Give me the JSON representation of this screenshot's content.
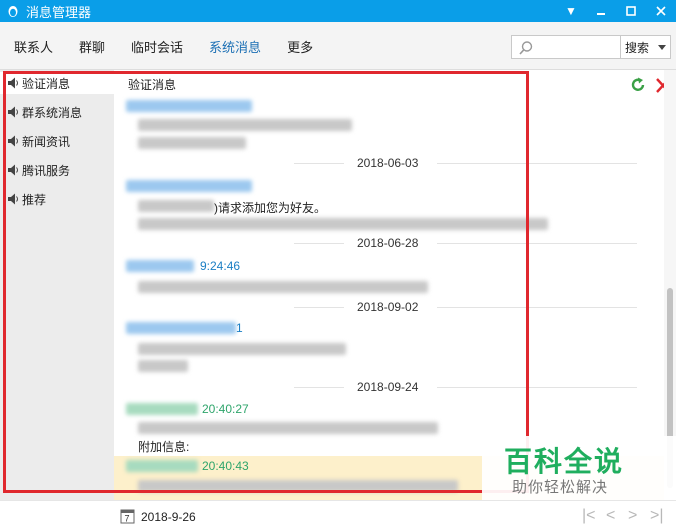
{
  "window": {
    "title": "消息管理器"
  },
  "tabs": [
    {
      "label": "联系人"
    },
    {
      "label": "群聊"
    },
    {
      "label": "临时会话"
    },
    {
      "label": "系统消息"
    },
    {
      "label": "更多"
    }
  ],
  "search": {
    "button_label": "搜索"
  },
  "sidebar": {
    "items": [
      {
        "label": "验证消息"
      },
      {
        "label": "群系统消息"
      },
      {
        "label": "新闻资讯"
      },
      {
        "label": "腾讯服务"
      },
      {
        "label": "推荐"
      }
    ]
  },
  "main": {
    "section_title": "验证消息",
    "dates": [
      "2018-06-03",
      "2018-06-28",
      "2018-09-02",
      "2018-09-24"
    ],
    "messages": [
      {
        "time": ""
      },
      {
        "time": "",
        "text": ")请求添加您为好友。"
      },
      {
        "time": "9:24:46"
      },
      {
        "time": "1"
      },
      {
        "time": "20:40:27",
        "text": "附加信息:"
      },
      {
        "time": "20:40:43"
      }
    ]
  },
  "bottom": {
    "current_date": "2018-9-26"
  },
  "watermark": {
    "title": "百科全说",
    "subtitle": "助你轻松解决"
  },
  "colors": {
    "titlebar": "#0a9ee8",
    "active_tab": "#1b6fb4",
    "annotation": "#e0282e",
    "watermark": "#1fae5e",
    "blue_name": "#1b7fc4",
    "green_name": "#2ea56b"
  }
}
